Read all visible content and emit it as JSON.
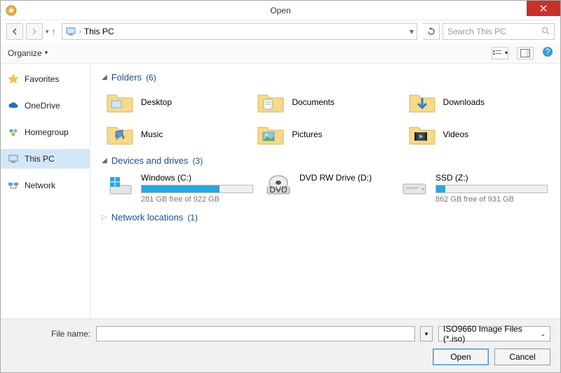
{
  "window": {
    "title": "Open"
  },
  "nav": {
    "location": "This PC",
    "search_placeholder": "Search This PC"
  },
  "toolbar": {
    "organize": "Organize"
  },
  "sidebar": {
    "items": [
      {
        "label": "Favorites"
      },
      {
        "label": "OneDrive"
      },
      {
        "label": "Homegroup"
      },
      {
        "label": "This PC"
      },
      {
        "label": "Network"
      }
    ]
  },
  "groups": {
    "folders": {
      "title": "Folders",
      "count": "(6)"
    },
    "drives": {
      "title": "Devices and drives",
      "count": "(3)"
    },
    "network": {
      "title": "Network locations",
      "count": "(1)"
    }
  },
  "folders": [
    {
      "label": "Desktop"
    },
    {
      "label": "Documents"
    },
    {
      "label": "Downloads"
    },
    {
      "label": "Music"
    },
    {
      "label": "Pictures"
    },
    {
      "label": "Videos"
    }
  ],
  "drives": [
    {
      "label": "Windows (C:)",
      "free": "281 GB free of 922 GB",
      "fill_pct": 70
    },
    {
      "label": "DVD RW Drive (D:)",
      "free": "",
      "fill_pct": null
    },
    {
      "label": "SSD (Z:)",
      "free": "862 GB free of 931 GB",
      "fill_pct": 8
    }
  ],
  "bottom": {
    "filename_label": "File name:",
    "filter": "ISO9660 Image Files (*.iso)",
    "open": "Open",
    "cancel": "Cancel"
  }
}
